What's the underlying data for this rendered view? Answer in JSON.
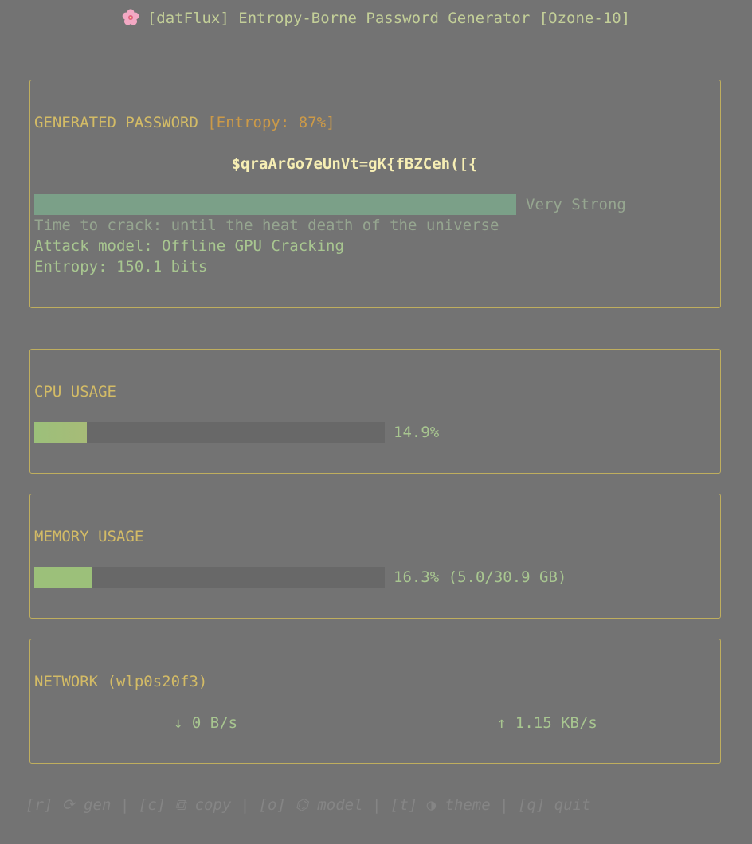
{
  "app": {
    "title": "[datFlux] Entropy-Borne Password Generator [Ozone-10]",
    "logo_icon": "cherry-blossom-icon"
  },
  "password_panel": {
    "heading": "GENERATED PASSWORD",
    "entropy_tag": "[Entropy: 87%]",
    "entropy_percent": 87,
    "password": "$qraArGo7eUnVt=gK{fBZCeh([{",
    "strength_label": "Very Strong",
    "time_to_crack": "Time to crack: until the heat death of the universe",
    "attack_model": "Attack model: Offline GPU Cracking",
    "entropy_bits": "Entropy: 150.1 bits"
  },
  "cpu_panel": {
    "heading": "CPU USAGE",
    "usage_text": "14.9%",
    "usage_percent": 14.9
  },
  "memory_panel": {
    "heading": "MEMORY USAGE",
    "usage_text": "16.3% (5.0/30.9 GB)",
    "usage_percent": 16.3
  },
  "network_panel": {
    "heading": "NETWORK (wlp0s20f3)",
    "download": "↓ 0 B/s",
    "upload": "↑ 1.15 KB/s"
  },
  "footer": {
    "hint": "[r] ⟳ gen | [c] ⧉ copy | [o] ⌬ model | [t] ◑ theme | [q] quit"
  },
  "colors": {
    "background": "#737373",
    "border": "#bfae5e",
    "heading": "#d3bb66",
    "accent_green": "#9cc07a",
    "strength_bar": "#7ba088"
  }
}
